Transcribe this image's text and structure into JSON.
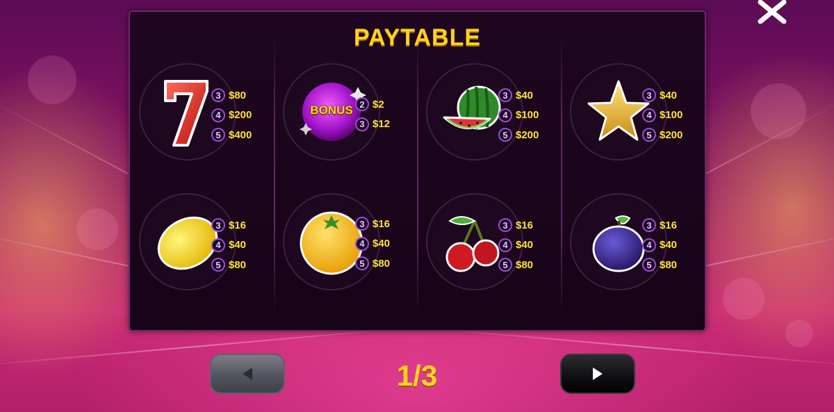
{
  "title": "PAYTABLE",
  "pager": "1/3",
  "symbols": [
    {
      "name": "seven",
      "pays": [
        {
          "n": "3",
          "v": "$80"
        },
        {
          "n": "4",
          "v": "$200"
        },
        {
          "n": "5",
          "v": "$400"
        }
      ]
    },
    {
      "name": "bonus",
      "label": "BONUS",
      "pays": [
        {
          "n": "2",
          "v": "$2"
        },
        {
          "n": "3",
          "v": "$12"
        }
      ]
    },
    {
      "name": "watermelon",
      "pays": [
        {
          "n": "3",
          "v": "$40"
        },
        {
          "n": "4",
          "v": "$100"
        },
        {
          "n": "5",
          "v": "$200"
        }
      ]
    },
    {
      "name": "star",
      "pays": [
        {
          "n": "3",
          "v": "$40"
        },
        {
          "n": "4",
          "v": "$100"
        },
        {
          "n": "5",
          "v": "$200"
        }
      ]
    },
    {
      "name": "lemon",
      "pays": [
        {
          "n": "3",
          "v": "$16"
        },
        {
          "n": "4",
          "v": "$40"
        },
        {
          "n": "5",
          "v": "$80"
        }
      ]
    },
    {
      "name": "orange",
      "pays": [
        {
          "n": "3",
          "v": "$16"
        },
        {
          "n": "4",
          "v": "$40"
        },
        {
          "n": "5",
          "v": "$80"
        }
      ]
    },
    {
      "name": "cherry",
      "pays": [
        {
          "n": "3",
          "v": "$16"
        },
        {
          "n": "4",
          "v": "$40"
        },
        {
          "n": "5",
          "v": "$80"
        }
      ]
    },
    {
      "name": "plum",
      "pays": [
        {
          "n": "3",
          "v": "$16"
        },
        {
          "n": "4",
          "v": "$40"
        },
        {
          "n": "5",
          "v": "$80"
        }
      ]
    }
  ],
  "colors": {
    "accent": "#ffd21f",
    "badge_border": "#9a4dcf",
    "panel": "#1e0620"
  },
  "icons": {
    "prev": "arrow-left-icon",
    "next": "arrow-right-icon",
    "close": "close-icon"
  }
}
